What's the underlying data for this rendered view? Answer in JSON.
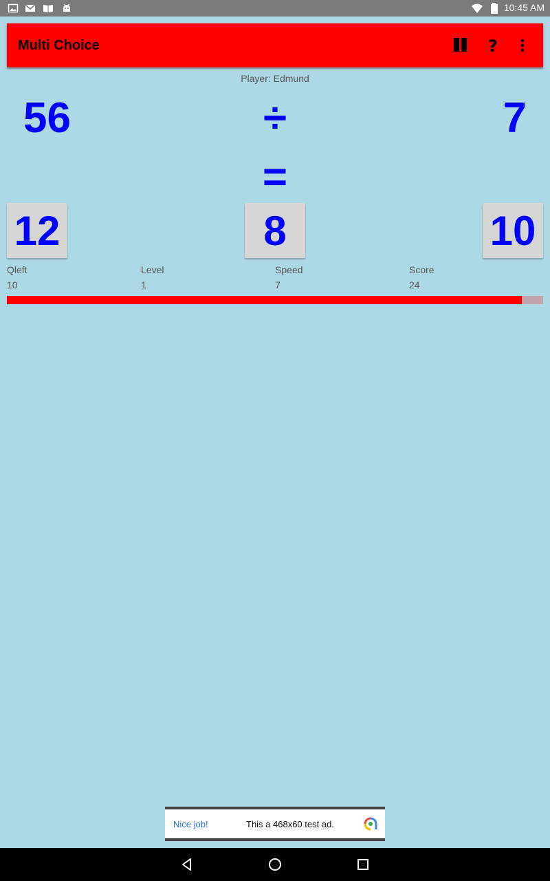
{
  "status_bar": {
    "time": "10:45 AM",
    "icons": [
      "image-icon",
      "gmail-icon",
      "book-icon",
      "android-icon",
      "wifi-icon",
      "battery-icon"
    ]
  },
  "app_bar": {
    "title": "Multi Choice",
    "actions": [
      "pause-icon",
      "help-icon",
      "more-options-icon"
    ],
    "background_color": "#ff0000"
  },
  "player": {
    "label": "Player: Edmund"
  },
  "question": {
    "left_operand": "56",
    "operator": "÷",
    "right_operand": "7",
    "equals": "="
  },
  "answers": [
    "12",
    "8",
    "10"
  ],
  "stats": [
    {
      "label": "Qleft",
      "value": "10"
    },
    {
      "label": "Level",
      "value": "1"
    },
    {
      "label": "Speed",
      "value": "7"
    },
    {
      "label": "Score",
      "value": "24"
    }
  ],
  "progress": {
    "fraction": 0.96,
    "fill_color": "#ff0000",
    "track_color": "#c2a4ad"
  },
  "ad": {
    "nice_text": "Nice job!",
    "message": "This a 468x60 test ad."
  },
  "nav_bar": {
    "buttons": [
      "back-icon",
      "home-icon",
      "recents-icon"
    ]
  }
}
